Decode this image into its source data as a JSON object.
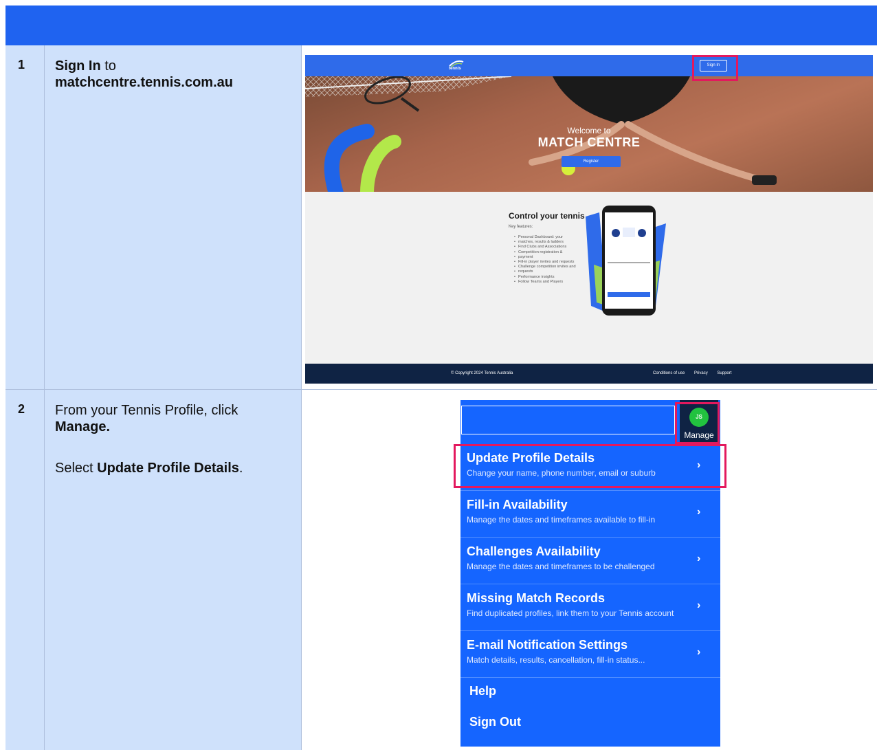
{
  "steps": [
    {
      "number": "1",
      "bold": "Sign In",
      "text": " to",
      "bold2": "matchcentre.tennis.com.au"
    },
    {
      "number": "2",
      "line1": "From your Tennis Profile, click",
      "line1_bold": "Manage.",
      "line2": "Select ",
      "line2_bold": "Update Profile Details",
      "line2_end": "."
    }
  ],
  "site": {
    "logo_text": "tennis",
    "signin_label": "Sign In",
    "welcome": "Welcome to",
    "match_centre": "MATCH CENTRE",
    "register_label": "Register",
    "section_title": "Control your tennis",
    "key_features_label": "Key features:",
    "features": [
      "Personal Dashboard: your",
      "matches, results & ladders",
      "Find Clubs and Associations",
      "Competition registration &",
      "payment",
      "Fill-in player invites and requests",
      "Challenge competition invites and",
      "requests",
      "Performance insights",
      "Follow Teams and Players"
    ],
    "footer_copyright": "© Copyright 2024 Tennis Australia",
    "footer_links": [
      "Conditions of use",
      "Privacy",
      "Support"
    ]
  },
  "menu": {
    "avatar_initials": "JS",
    "manage_label": "Manage",
    "items": [
      {
        "title": "Update Profile Details",
        "subtitle": "Change your name, phone number, email or suburb"
      },
      {
        "title": "Fill-in Availability",
        "subtitle": "Manage the dates and timeframes available to fill-in"
      },
      {
        "title": "Challenges Availability",
        "subtitle": "Manage the dates and timeframes to be challenged"
      },
      {
        "title": "Missing Match Records",
        "subtitle": "Find duplicated profiles, link them to your Tennis account"
      },
      {
        "title": "E-mail Notification Settings",
        "subtitle": "Match details, results, cancellation, fill-in status..."
      }
    ],
    "help_label": "Help",
    "signout_label": "Sign Out"
  },
  "colors": {
    "brand_blue": "#1565ff",
    "highlight": "#e3195e",
    "table_cell": "#cfe1fb"
  }
}
